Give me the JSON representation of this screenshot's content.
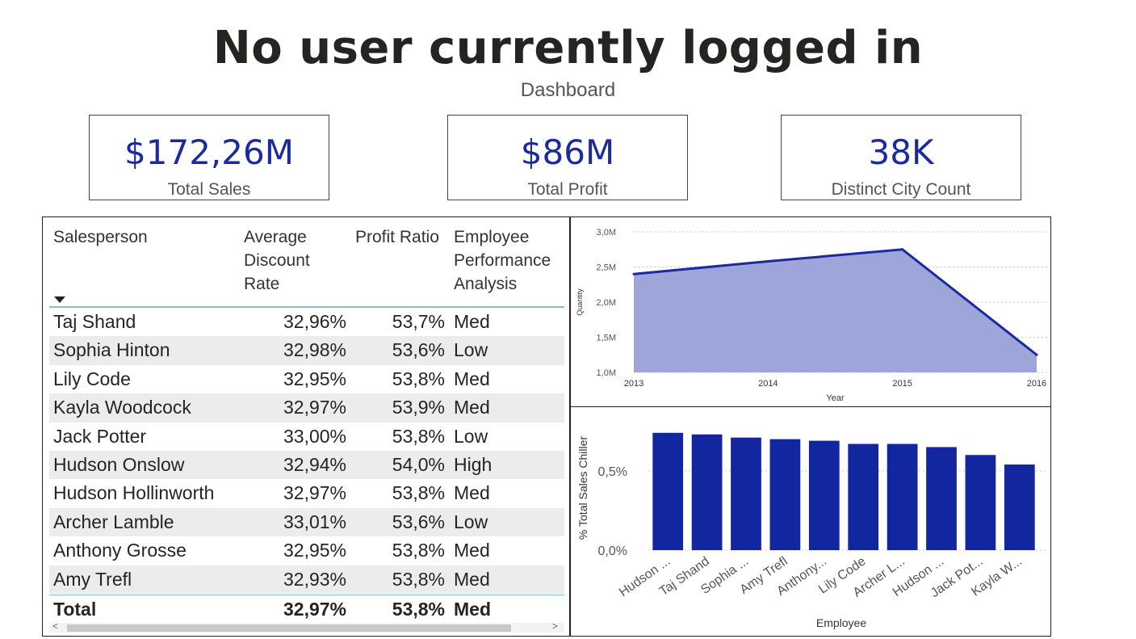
{
  "header": {
    "title": "No user currently logged in",
    "subtitle": "Dashboard"
  },
  "kpis": [
    {
      "value": "$172,26M",
      "label": "Total Sales"
    },
    {
      "value": "$86M",
      "label": "Total Profit"
    },
    {
      "value": "38K",
      "label": "Distinct City Count"
    }
  ],
  "table": {
    "headers": {
      "salesperson": "Salesperson",
      "discount_l1": "Average",
      "discount_l2": "Discount",
      "discount_l3": "Rate",
      "profit": "Profit Ratio",
      "perf_l1": "Employee",
      "perf_l2": "Performance",
      "perf_l3": "Analysis"
    },
    "rows": [
      {
        "name": "Taj Shand",
        "discount": "32,96%",
        "profit": "53,7%",
        "perf": "Med"
      },
      {
        "name": "Sophia Hinton",
        "discount": "32,98%",
        "profit": "53,6%",
        "perf": "Low"
      },
      {
        "name": "Lily Code",
        "discount": "32,95%",
        "profit": "53,8%",
        "perf": "Med"
      },
      {
        "name": "Kayla Woodcock",
        "discount": "32,97%",
        "profit": "53,9%",
        "perf": "Med"
      },
      {
        "name": "Jack Potter",
        "discount": "33,00%",
        "profit": "53,8%",
        "perf": "Low"
      },
      {
        "name": "Hudson Onslow",
        "discount": "32,94%",
        "profit": "54,0%",
        "perf": "High"
      },
      {
        "name": "Hudson Hollinworth",
        "discount": "32,97%",
        "profit": "53,8%",
        "perf": "Med"
      },
      {
        "name": "Archer Lamble",
        "discount": "33,01%",
        "profit": "53,6%",
        "perf": "Low"
      },
      {
        "name": "Anthony Grosse",
        "discount": "32,95%",
        "profit": "53,8%",
        "perf": "Med"
      },
      {
        "name": "Amy Trefl",
        "discount": "32,93%",
        "profit": "53,8%",
        "perf": "Med"
      }
    ],
    "total": {
      "name": "Total",
      "discount": "32,97%",
      "profit": "53,8%",
      "perf": "Med"
    },
    "scroll_left": "<",
    "scroll_right": ">"
  },
  "chart_data": [
    {
      "type": "area",
      "title": "",
      "xlabel": "Year",
      "ylabel": "Quantity",
      "x": [
        2013,
        2014,
        2015,
        2016
      ],
      "y": [
        2400000,
        2580000,
        2750000,
        1250000
      ],
      "yticks": [
        "1,0M",
        "1,5M",
        "2,0M",
        "2,5M",
        "3,0M"
      ],
      "ylim": [
        1000000,
        3000000
      ],
      "grid": true,
      "color": "#1b2a9e",
      "fill_color": "#9ea5d9"
    },
    {
      "type": "bar",
      "title": "",
      "xlabel": "Employee",
      "ylabel": "% Total Sales Chiller",
      "categories": [
        "Hudson ...",
        "Taj Shand",
        "Sophia ...",
        "Amy Trefl",
        "Anthony...",
        "Lily Code",
        "Archer L...",
        "Hudson ...",
        "Jack Pot...",
        "Kayla W..."
      ],
      "values": [
        0.74,
        0.73,
        0.71,
        0.7,
        0.69,
        0.67,
        0.67,
        0.65,
        0.6,
        0.54
      ],
      "yticks": [
        "0,0%",
        "0,5%"
      ],
      "ylim": [
        0,
        0.8
      ],
      "grid": true,
      "color": "#1226a0"
    }
  ]
}
